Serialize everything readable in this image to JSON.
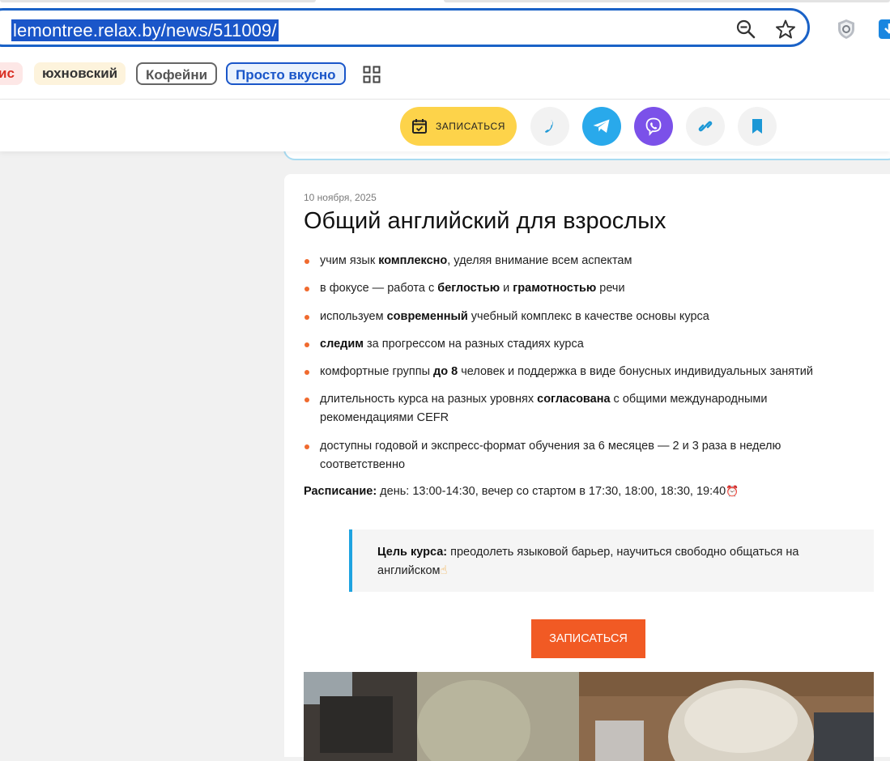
{
  "browser": {
    "url": "lemontree.relax.by/news/511009/",
    "icons": [
      "zoom-out-icon",
      "star-icon",
      "shield-extension-icon",
      "download-extension-icon"
    ]
  },
  "bookmarks": [
    {
      "label": "ис",
      "bg": "#fde7e6",
      "color": "#d93025"
    },
    {
      "label": "юхновский",
      "bg": "#fdf3dc",
      "color": "#333333"
    },
    {
      "label": "Кофейни",
      "bg": "#ffffff",
      "color": "#555555",
      "border": "#666666"
    },
    {
      "label": "Просто вкусно",
      "bg": "#eaf2fd",
      "color": "#1a56c9",
      "border": "#1a56c9"
    }
  ],
  "header": {
    "signup_label": "ЗАПИСАТЬСЯ",
    "buttons": [
      "phone-icon",
      "telegram-icon",
      "viber-icon",
      "link-icon",
      "bookmark-icon"
    ]
  },
  "colors": {
    "accent_yellow": "#fdd34a",
    "telegram": "#29a9eb",
    "viber": "#7b51e9",
    "bullet": "#f06a2e",
    "cta": "#f15a24",
    "quote_border": "#1ea3e0"
  },
  "article": {
    "date": "10 ноября, 2025",
    "title": "Общий английский для взрослых",
    "bullets": [
      [
        {
          "t": "учим язык "
        },
        {
          "t": "комплексно",
          "b": true
        },
        {
          "t": ", уделяя внимание всем аспектам"
        }
      ],
      [
        {
          "t": "в фокусе — работа с "
        },
        {
          "t": "беглостью",
          "b": true
        },
        {
          "t": " и "
        },
        {
          "t": "грамотностью",
          "b": true
        },
        {
          "t": " речи"
        }
      ],
      [
        {
          "t": "используем "
        },
        {
          "t": "современный",
          "b": true
        },
        {
          "t": " учебный комплекс в качестве основы курса"
        }
      ],
      [
        {
          "t": "следим",
          "b": true
        },
        {
          "t": " за прогрессом на разных стадиях курса"
        }
      ],
      [
        {
          "t": "комфортные группы "
        },
        {
          "t": "до 8",
          "b": true
        },
        {
          "t": " человек и поддержка в виде бонусных индивидуальных занятий"
        }
      ],
      [
        {
          "t": "длительность курса на разных уровнях "
        },
        {
          "t": "согласована",
          "b": true
        },
        {
          "t": " с общими международными рекомендациями CEFR"
        }
      ],
      [
        {
          "t": "доступны годовой и экспресс-формат обучения за 6 месяцев — 2 и 3 раза в неделю соответственно"
        }
      ]
    ],
    "schedule_label": "Расписание:",
    "schedule_text": " день: 13:00-14:30, вечер со стартом в 17:30, 18:00, 18:30, 19:40",
    "schedule_emoji": "⏰",
    "goal_label": "Цель курса:",
    "goal_text": " преодолеть языковой барьер, научиться свободно общаться на английском",
    "goal_emoji": "☝",
    "cta_label": "ЗАПИСАТЬСЯ"
  }
}
